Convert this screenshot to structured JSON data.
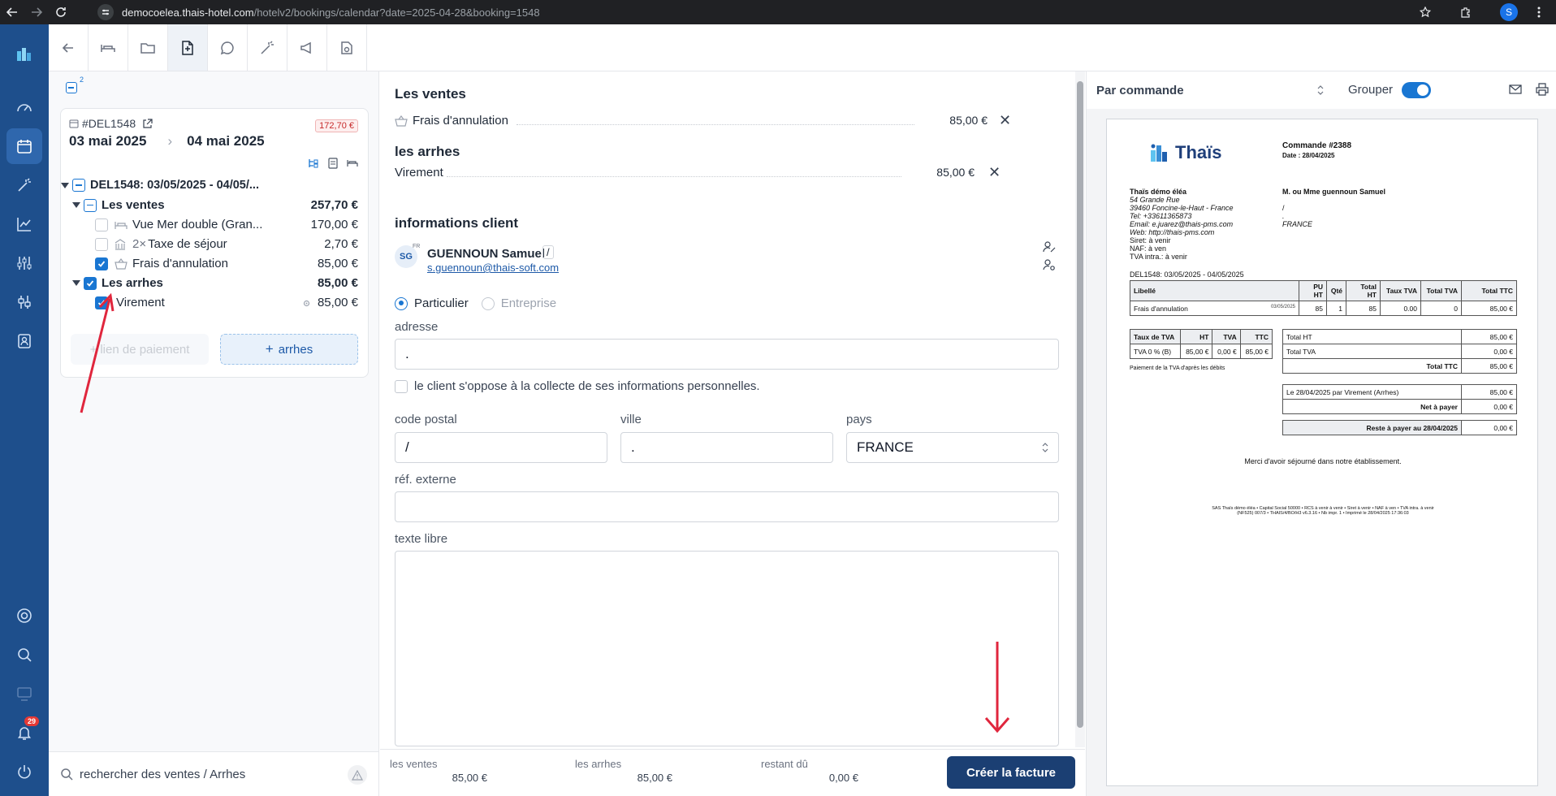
{
  "browser": {
    "url_host": "democoelea.thais-hotel.com",
    "url_path": "/hotelv2/bookings/calendar?date=2025-04-28&booking=1548",
    "profile_initial": "S"
  },
  "nav": {
    "notifications_count": "29"
  },
  "left": {
    "badge_count": "2",
    "booking_ref": "#DEL1548",
    "balance_badge": "172,70 €",
    "date_from": "03 mai 2025",
    "date_to": "04 mai 2025",
    "tree_root": "DEL1548: 03/05/2025 - 04/05/...",
    "group_sales": {
      "label": "Les ventes",
      "amount": "257,70 €"
    },
    "items": [
      {
        "label": "Vue Mer double (Gran...",
        "amount": "170,00 €"
      },
      {
        "qty": "2×",
        "label": "Taxe de séjour",
        "amount": "2,70 €"
      },
      {
        "label": "Frais d'annulation",
        "amount": "85,00 €"
      }
    ],
    "group_deposits": {
      "label": "Les arrhes",
      "amount": "85,00 €"
    },
    "deposit_item": {
      "label": "Virement",
      "amount": "85,00 €"
    },
    "btn_payment_link": "lien de paiement",
    "btn_add_deposit": "arrhes",
    "search_placeholder": "rechercher des ventes / Arrhes"
  },
  "middle": {
    "sales_title": "Les ventes",
    "sales_line": {
      "label": "Frais d'annulation",
      "amount": "85,00 €"
    },
    "deposits_title": "les arrhes",
    "deposit_line": {
      "label": "Virement",
      "amount": "85,00 €"
    },
    "client_title": "informations client",
    "avatar": "SG",
    "lang": "FR",
    "client_name": "GUENNOUN Samuel",
    "client_slash": "/",
    "client_email": "s.guennoun@thais-soft.com",
    "type_individual": "Particulier",
    "type_company": "Entreprise",
    "address_label": "adresse",
    "address_value": ".",
    "privacy_label": "le client s'oppose à la collecte de ses informations personnelles.",
    "postal_label": "code postal",
    "postal_value": "/",
    "city_label": "ville",
    "city_value": ".",
    "country_label": "pays",
    "country_value": "FRANCE",
    "ext_ref_label": "réf. externe",
    "free_text_label": "texte libre"
  },
  "footer": {
    "sales_label": "les ventes",
    "sales_value": "85,00 €",
    "deposits_label": "les arrhes",
    "deposits_value": "85,00 €",
    "due_label": "restant dû",
    "due_value": "0,00 €",
    "create_button": "Créer la facture"
  },
  "right": {
    "mode_select": "Par commande",
    "group_label": "Grouper"
  },
  "invoice": {
    "logo_text": "Thaïs",
    "order_title": "Commande #2388",
    "order_date": "Date : 28/04/2025",
    "hotel_lines": [
      "Thaïs démo éléa",
      "54 Grande Rue",
      "39460 Foncine-le-Haut - France",
      "Tel: +33611365873",
      "Email: e.juarez@thais-pms.com",
      "Web: http://thais-pms.com",
      "Siret: à venir",
      "NAF: à ven",
      "TVA intra.: à venir"
    ],
    "client_lines": [
      "M. ou Mme guennoun Samuel",
      "",
      "/",
      ".",
      "FRANCE"
    ],
    "booking_line": "DEL1548: 03/05/2025 - 04/05/2025",
    "table_headers": [
      "Libellé",
      "PU HT",
      "Qté",
      "Total HT",
      "Taux TVA",
      "Total TVA",
      "Total TTC"
    ],
    "table_row": {
      "label": "Frais d'annulation",
      "date": "03/05/2025",
      "pu": "85",
      "qty": "1",
      "total_ht": "85",
      "rate": "0.00",
      "tva": "0",
      "ttc": "85,00 €"
    },
    "vat_headers": [
      "Taux de TVA",
      "HT",
      "TVA",
      "TTC"
    ],
    "vat_row": [
      "TVA 0 % (B)",
      "85,00 €",
      "0,00 €",
      "85,00 €"
    ],
    "vat_note": "Paiement de la TVA d'après les débits",
    "totals": [
      {
        "label": "Total HT",
        "value": "85,00 €"
      },
      {
        "label": "Total TVA",
        "value": "0,00 €"
      },
      {
        "label": "Total TTC",
        "value": "85,00 €"
      }
    ],
    "payment": {
      "label": "Le 28/04/2025 par Virement (Arrhes)",
      "value": "85,00 €"
    },
    "net": {
      "label": "Net à payer",
      "value": "0,00 €"
    },
    "remaining": {
      "label": "Reste à payer au 28/04/2025",
      "value": "0,00 €"
    },
    "thanks": "Merci d'avoir séjourné dans notre établissement.",
    "legal_1": "SAS Thaïs démo éléa • Capital Social 50000 • RCS à venir à venir • Siret à venir • NAF à ven • TVA intra. à venir",
    "legal_2": "(NF525) 007/3 • THAIS/4/BO/H3 v6.3.16 • Nb impr. 1 • Imprimé le 28/04/2025 17:36:03"
  }
}
